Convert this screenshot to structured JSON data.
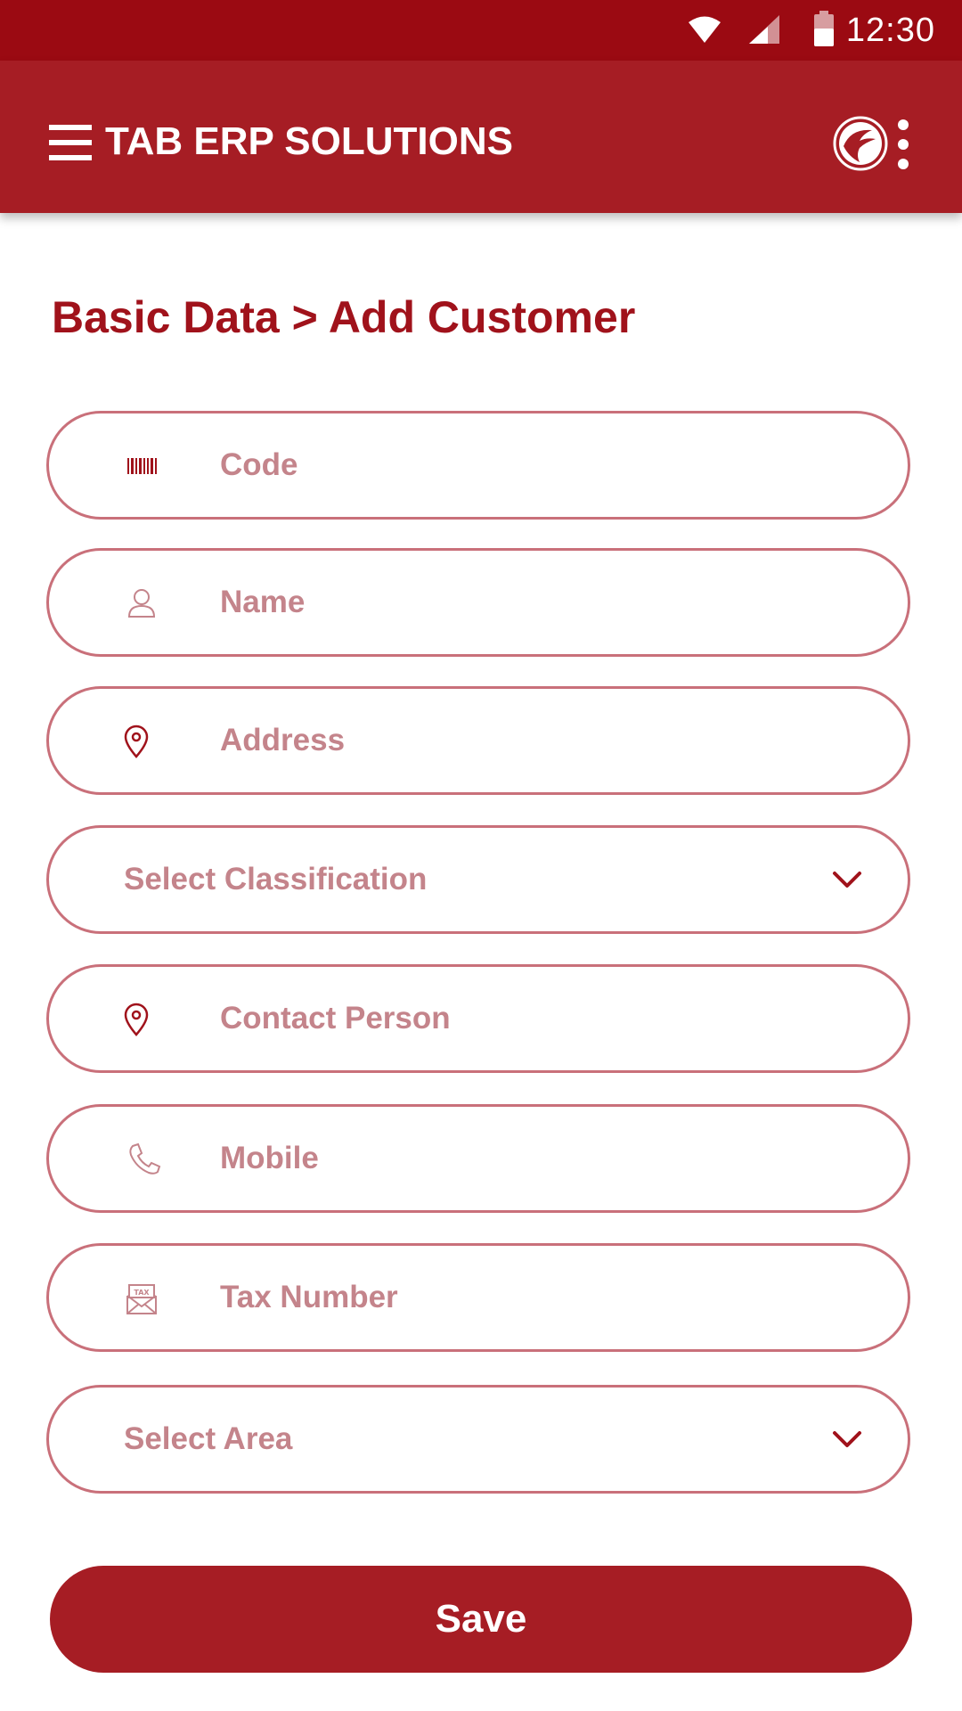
{
  "status_bar": {
    "time": "12:30"
  },
  "app_bar": {
    "title": "TAB ERP SOLUTIONS"
  },
  "page": {
    "breadcrumb": "Basic Data > Add Customer"
  },
  "form": {
    "fields": [
      {
        "placeholder": "Code",
        "icon": "barcode-icon"
      },
      {
        "placeholder": "Name",
        "icon": "person-icon"
      },
      {
        "placeholder": "Address",
        "icon": "location-pin-icon"
      },
      {
        "placeholder": "Select Classification",
        "type": "select",
        "icon": "chevron-down-icon"
      },
      {
        "placeholder": "Contact Person",
        "icon": "location-pin-icon"
      },
      {
        "placeholder": "Mobile",
        "icon": "phone-icon"
      },
      {
        "placeholder": "Tax Number",
        "icon": "tax-envelope-icon"
      },
      {
        "placeholder": "Select Area",
        "type": "select",
        "icon": "chevron-down-icon"
      }
    ],
    "save_label": "Save"
  },
  "colors": {
    "status_bar": "#9b0a12",
    "app_bar": "#a61d24",
    "accent_text": "#a0121b",
    "field_border": "#c9707a",
    "placeholder": "#c4848b"
  }
}
